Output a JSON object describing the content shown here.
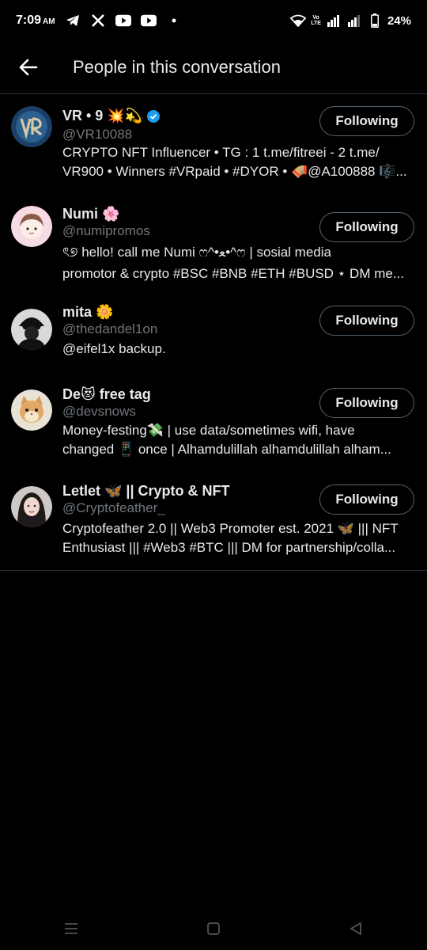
{
  "status_bar": {
    "time": "7:09",
    "ampm": "AM",
    "battery": "24%",
    "network_label_top": "Vo",
    "network_label_bottom": "LTE",
    "icons": [
      "telegram-icon",
      "x-icon",
      "youtube-icon",
      "youtube-icon",
      "dot-icon",
      "wifi-icon",
      "signal-icon",
      "signal-icon",
      "battery-icon"
    ]
  },
  "header": {
    "title": "People in this conversation",
    "back_icon": "back-arrow-icon"
  },
  "people": [
    {
      "name": "VR • 9 💥💫",
      "handle": "@VR10088",
      "verified": true,
      "bio": [
        "CRYPTO NFT Influencer • TG : 1 t.me/fitreei - 2 t.me/",
        "VR900 • Winners #VRpaid • #DYOR • 🪗@A100888 🎼..."
      ],
      "button": "Following"
    },
    {
      "name": "Numi 🌸",
      "handle": "@numipromos",
      "verified": false,
      "bio": [
        "ৎ୭ hello! call me Numi ෆ^•ﻌ•^ෆ | sosial media",
        "promotor & crypto #BSC #BNB #ETH #BUSD ⋆ DM me..."
      ],
      "button": "Following"
    },
    {
      "name": "mita 🌼",
      "handle": "@thedandel1on",
      "verified": false,
      "bio": [
        "@eifel1x backup."
      ],
      "button": "Following"
    },
    {
      "name": "De😻 free tag",
      "handle": "@devsnows",
      "verified": false,
      "bio": [
        "Money-festing💸 | use data/sometimes wifi, have",
        "changed 📱 once | Alhamdulillah alhamdulillah alham..."
      ],
      "button": "Following"
    },
    {
      "name": "Letlet 🦋 || Crypto & NFT",
      "handle": "@Cryptofeather_",
      "verified": false,
      "bio": [
        "Cryptofeather 2.0 || Web3 Promoter est. 2021 🦋 ||| NFT",
        "Enthusiast ||| #Web3 #BTC ||| DM for partnership/colla..."
      ],
      "button": "Following"
    }
  ],
  "colors": {
    "background": "#000000",
    "text": "#e7e9ea",
    "secondary_text": "#71767b",
    "divider": "#2f3336",
    "verified": "#1d9bf0"
  },
  "nav_bar": {
    "icons": [
      "recent-apps-icon",
      "home-icon",
      "back-icon"
    ]
  }
}
